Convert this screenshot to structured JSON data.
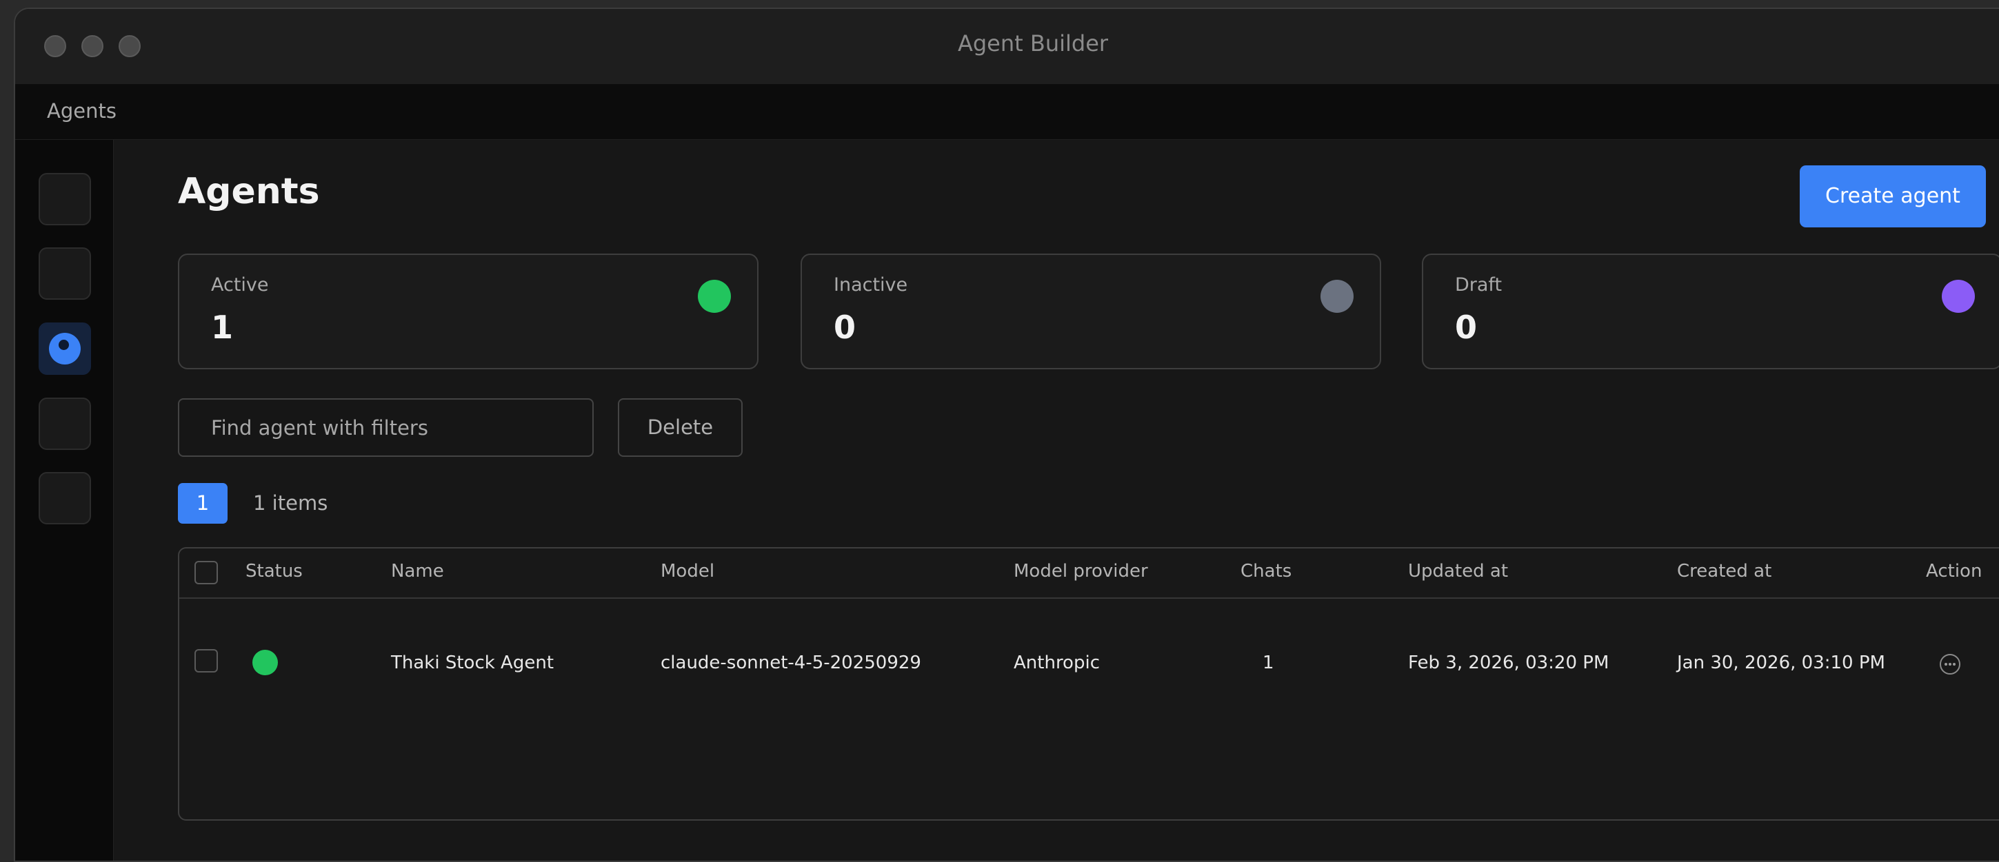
{
  "window": {
    "title": "Agent Builder"
  },
  "menubar": {
    "label": "Agents"
  },
  "rail": {
    "items": [
      {
        "icon": "nav-icon",
        "active": false
      },
      {
        "icon": "nav-icon",
        "active": false
      },
      {
        "icon": "agents-icon",
        "active": true
      },
      {
        "icon": "nav-icon",
        "active": false
      },
      {
        "icon": "nav-icon",
        "active": false
      }
    ]
  },
  "header": {
    "title": "Agents",
    "create_label": "Create agent"
  },
  "stats": [
    {
      "label": "Active",
      "value": "1",
      "color": "#22c55e"
    },
    {
      "label": "Inactive",
      "value": "0",
      "color": "#6b7280"
    },
    {
      "label": "Draft",
      "value": "0",
      "color": "#8b5cf6"
    }
  ],
  "toolbar": {
    "search_placeholder": "Find agent with filters",
    "search_value": "",
    "delete_label": "Delete"
  },
  "pagination": {
    "current_page": "1",
    "items_label": "1 items"
  },
  "table": {
    "columns": [
      "Status",
      "Name",
      "Model",
      "Model provider",
      "Chats",
      "Updated at",
      "Created at",
      "Action"
    ],
    "rows": [
      {
        "status": "active",
        "status_color": "#22c55e",
        "name": "Thaki Stock Agent",
        "model": "claude-sonnet-4-5-20250929",
        "provider": "Anthropic",
        "chats": "1",
        "updated_at": "Feb 3, 2026, 03:20 PM",
        "created_at": "Jan 30, 2026, 03:10 PM",
        "action_icon": "more-icon"
      }
    ]
  },
  "colors": {
    "accent": "#3b82f6",
    "active": "#22c55e",
    "inactive": "#6b7280",
    "draft": "#8b5cf6"
  }
}
